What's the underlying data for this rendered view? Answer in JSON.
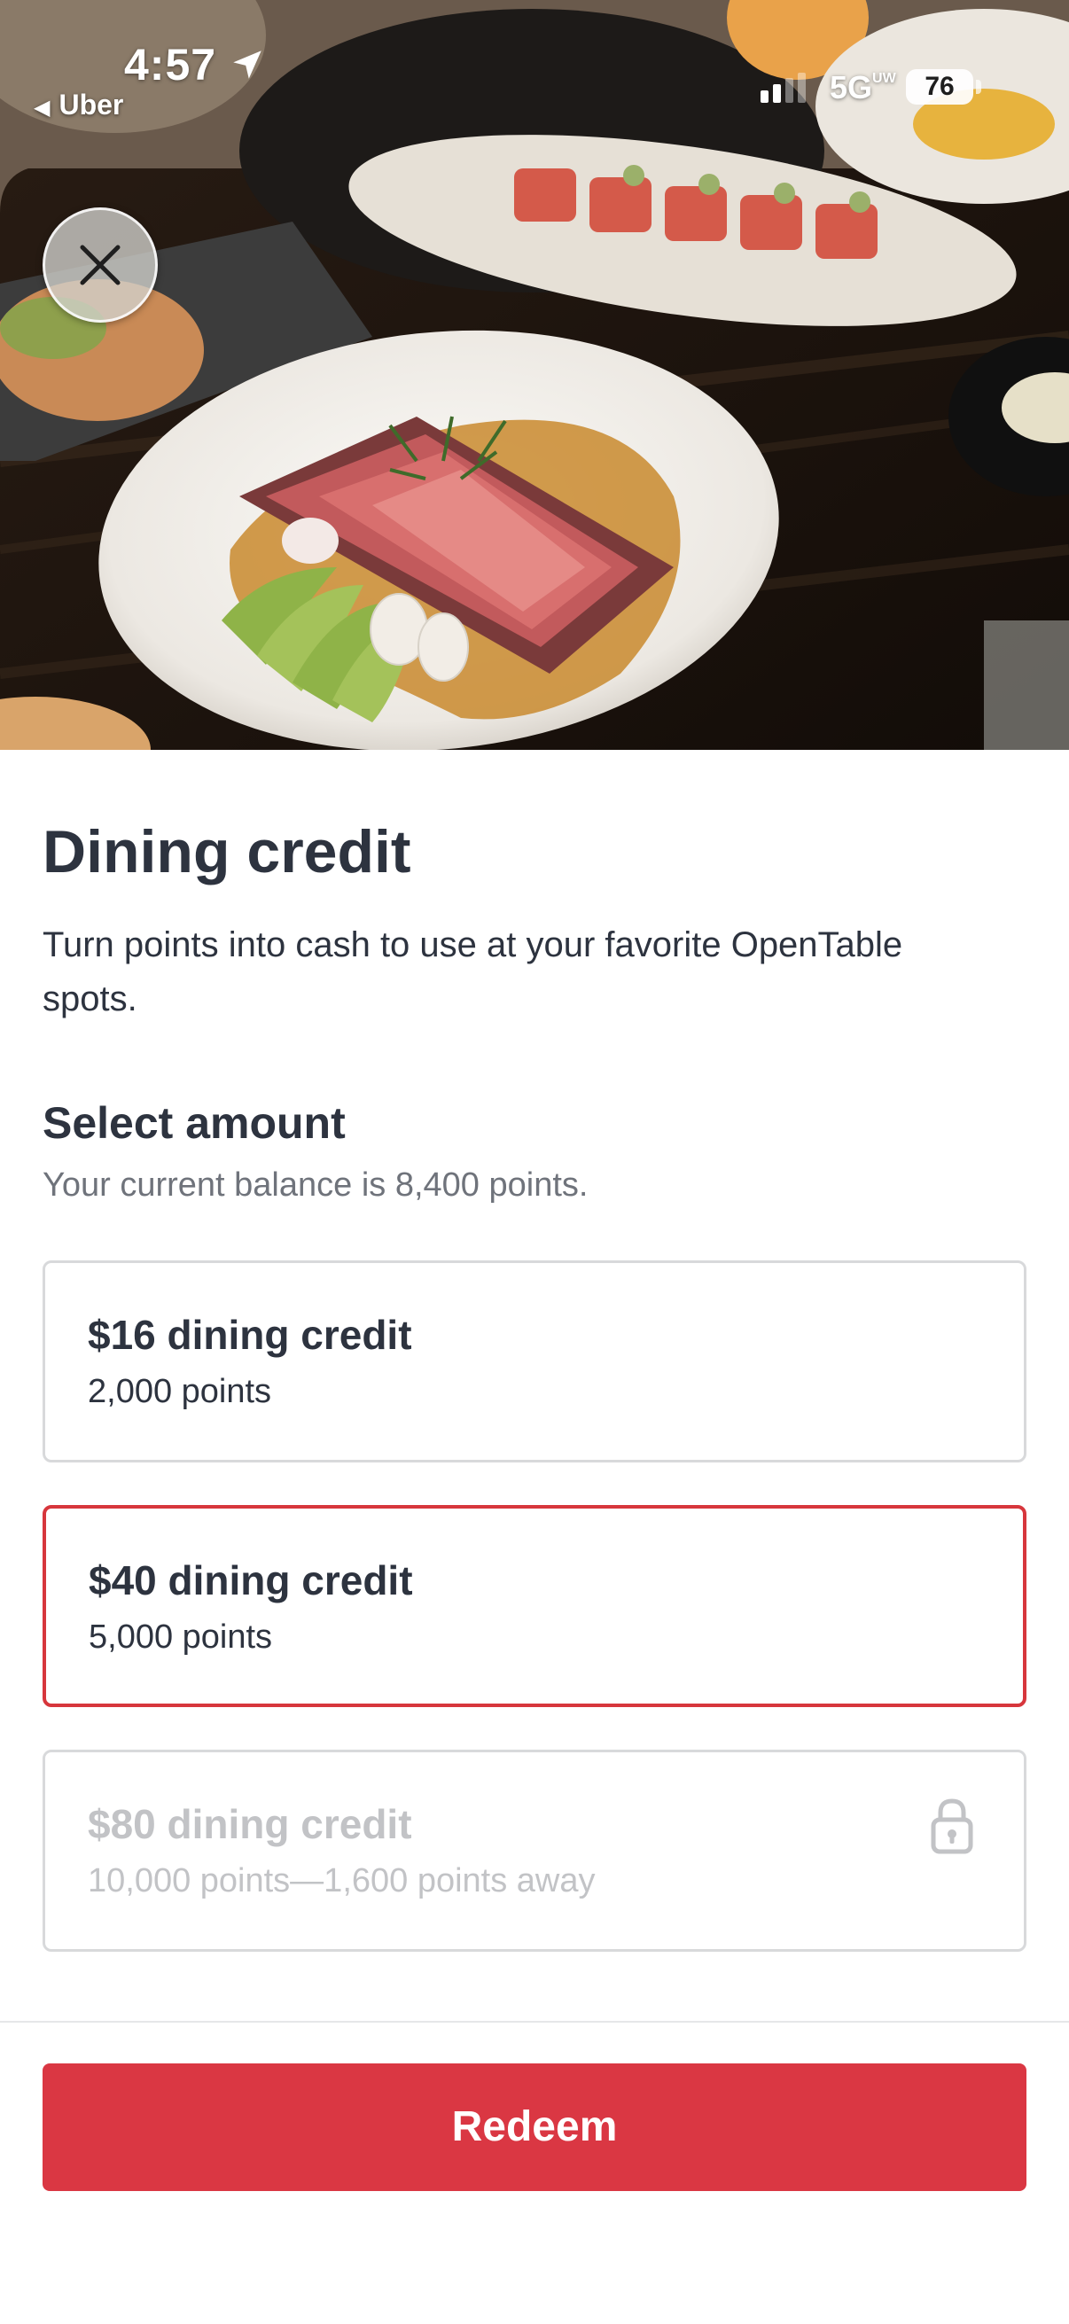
{
  "status_bar": {
    "time": "4:57",
    "back_app": "Uber",
    "network": "5G",
    "network_badge": "UW",
    "battery": "76"
  },
  "page": {
    "title": "Dining credit",
    "subtitle": "Turn points into cash to use at your favorite OpenTable spots."
  },
  "amount_section": {
    "title": "Select amount",
    "balance_text": "Your current balance is 8,400 points.",
    "options": [
      {
        "title": "$16 dining credit",
        "points": "2,000 points",
        "state": "available"
      },
      {
        "title": "$40 dining credit",
        "points": "5,000 points",
        "state": "selected"
      },
      {
        "title": "$80 dining credit",
        "points": "10,000 points—1,600 points away",
        "state": "locked"
      }
    ]
  },
  "actions": {
    "redeem_label": "Redeem"
  },
  "colors": {
    "accent": "#da3743",
    "text_primary": "#2d333f",
    "text_secondary": "#6f737b",
    "disabled_text": "#c2c3c6",
    "border": "#d8d9db"
  },
  "icons": {
    "close": "close-icon",
    "lock": "lock-icon",
    "location": "location-arrow-icon",
    "signal": "signal-icon"
  }
}
